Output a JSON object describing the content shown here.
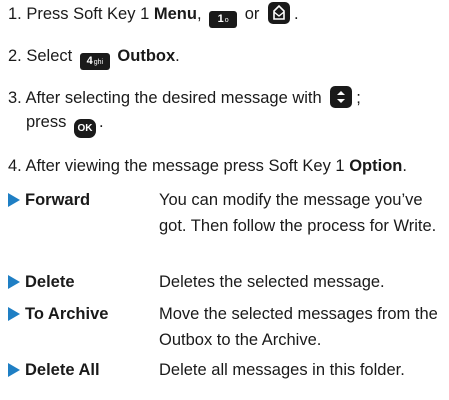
{
  "steps": [
    {
      "num": "1.",
      "pre": "Press Soft Key 1 ",
      "bold": "Menu",
      "sep": ",",
      "mid": "or",
      "end": "."
    },
    {
      "num": "2.",
      "pre": "Select",
      "bold": "Outbox",
      "end": "."
    },
    {
      "num": "3.",
      "pre": "After selecting the desired message with",
      "end": ";",
      "line2": "press",
      "end2": "."
    },
    {
      "num": "4.",
      "pre": "After viewing the message press Soft Key 1 ",
      "bold": "Option",
      "end": "."
    }
  ],
  "keys": {
    "key1": "1",
    "key1_sub": "o",
    "key4": "4",
    "key4_sub": "ghi",
    "ok": "OK"
  },
  "options": [
    {
      "name": "Forward",
      "desc": "You can modify the message you’ve got. Then follow the process for Write."
    },
    {
      "name": "Delete",
      "desc": "Deletes the selected message."
    },
    {
      "name": "To Archive",
      "desc": "Move the selected messages from the Outbox to the Archive."
    },
    {
      "name": "Delete All",
      "desc": "Delete all messages in this folder."
    }
  ],
  "colors": {
    "arrow": "#1f7fc4",
    "text": "#1a1a1a",
    "key": "#1a1a1a"
  }
}
